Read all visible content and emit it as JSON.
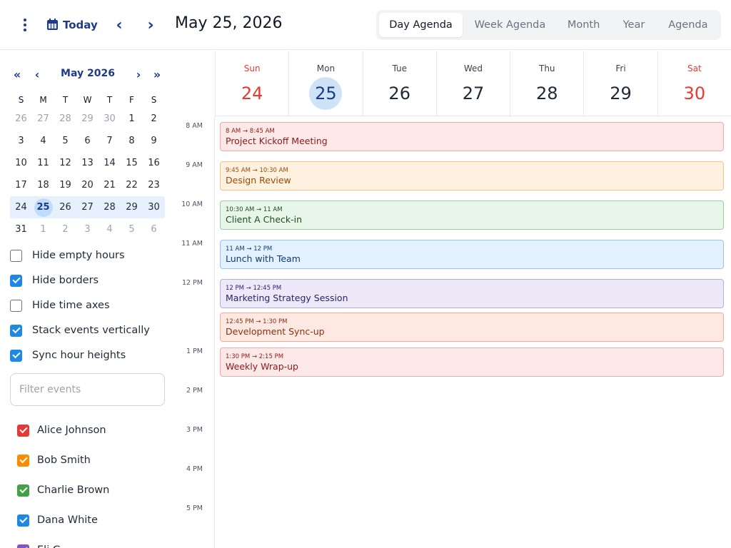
{
  "header": {
    "today_label": "Today",
    "prev_icon": "chevron-left-icon",
    "next_icon": "chevron-right-icon",
    "date_title": "May 25, 2026",
    "views": [
      {
        "label": "Day Agenda",
        "active": true
      },
      {
        "label": "Week Agenda",
        "active": false
      },
      {
        "label": "Month",
        "active": false
      },
      {
        "label": "Year",
        "active": false
      },
      {
        "label": "Agenda",
        "active": false
      }
    ]
  },
  "mini_calendar": {
    "title": "May 2026",
    "weekdays": [
      "S",
      "M",
      "T",
      "W",
      "T",
      "F",
      "S"
    ],
    "weeks": [
      [
        "26",
        "27",
        "28",
        "29",
        "30",
        "1",
        "2"
      ],
      [
        "3",
        "4",
        "5",
        "6",
        "7",
        "8",
        "9"
      ],
      [
        "10",
        "11",
        "12",
        "13",
        "14",
        "15",
        "16"
      ],
      [
        "17",
        "18",
        "19",
        "20",
        "21",
        "22",
        "23"
      ],
      [
        "24",
        "25",
        "26",
        "27",
        "28",
        "29",
        "30"
      ],
      [
        "31",
        "1",
        "2",
        "3",
        "4",
        "5",
        "6"
      ]
    ],
    "selected_week": 4,
    "selected_day": "25"
  },
  "options": [
    {
      "label": "Hide empty hours",
      "checked": false
    },
    {
      "label": "Hide borders",
      "checked": true
    },
    {
      "label": "Hide time axes",
      "checked": false
    },
    {
      "label": "Stack events vertically",
      "checked": true
    },
    {
      "label": "Sync hour heights",
      "checked": true
    }
  ],
  "filter": {
    "placeholder": "Filter events",
    "value": ""
  },
  "users": [
    {
      "name": "Alice Johnson",
      "color": "#e53935",
      "checked": true
    },
    {
      "name": "Bob Smith",
      "color": "#fb8c00",
      "checked": true
    },
    {
      "name": "Charlie Brown",
      "color": "#43a047",
      "checked": true
    },
    {
      "name": "Dana White",
      "color": "#1e88e5",
      "checked": true
    },
    {
      "name": "Eli G",
      "color": "#7e57c2",
      "checked": true
    }
  ],
  "week_days": [
    {
      "name": "Sun",
      "num": "24",
      "weekend": true,
      "selected": false
    },
    {
      "name": "Mon",
      "num": "25",
      "weekend": false,
      "selected": true
    },
    {
      "name": "Tue",
      "num": "26",
      "weekend": false,
      "selected": false
    },
    {
      "name": "Wed",
      "num": "27",
      "weekend": false,
      "selected": false
    },
    {
      "name": "Thu",
      "num": "28",
      "weekend": false,
      "selected": false
    },
    {
      "name": "Fri",
      "num": "29",
      "weekend": false,
      "selected": false
    },
    {
      "name": "Sat",
      "num": "30",
      "weekend": true,
      "selected": false
    }
  ],
  "hours": [
    "8 AM",
    "9 AM",
    "10 AM",
    "11 AM",
    "12 PM",
    "1 PM",
    "2 PM",
    "3 PM",
    "4 PM",
    "5 PM"
  ],
  "events": [
    {
      "time": "8 AM → 8:45 AM",
      "title": "Project Kickoff Meeting",
      "bg": "#fde8e8",
      "border": "#f1a9a9",
      "color": "#8b1a1a"
    },
    {
      "time": "9:45 AM → 10:30 AM",
      "title": "Design Review",
      "bg": "#fff1e0",
      "border": "#f6c48a",
      "color": "#9a4a00"
    },
    {
      "time": "10:30 AM → 11 AM",
      "title": "Client A Check-in",
      "bg": "#e8f5e9",
      "border": "#9ccf9f",
      "color": "#1b4d1e"
    },
    {
      "time": "11 AM → 12 PM",
      "title": "Lunch with Team",
      "bg": "#e3f0fd",
      "border": "#98c4ee",
      "color": "#0d3c73"
    },
    {
      "time": "12 PM → 12:45 PM",
      "title": "Marketing Strategy Session",
      "bg": "#ede9f8",
      "border": "#b7abe0",
      "color": "#2a1f6b"
    },
    {
      "time": "12:45 PM → 1:30 PM",
      "title": "Development Sync-up",
      "bg": "#fde9e1",
      "border": "#f3ae93",
      "color": "#8a2f10"
    },
    {
      "time": "1:30 PM → 2:15 PM",
      "title": "Weekly Wrap-up",
      "bg": "#fde8e8",
      "border": "#f1a9a9",
      "color": "#8b1a1a"
    }
  ],
  "icons": {
    "menu": "more-vertical-icon",
    "calendar": "calendar-icon",
    "first": "double-chevron-left-icon",
    "last": "double-chevron-right-icon"
  }
}
